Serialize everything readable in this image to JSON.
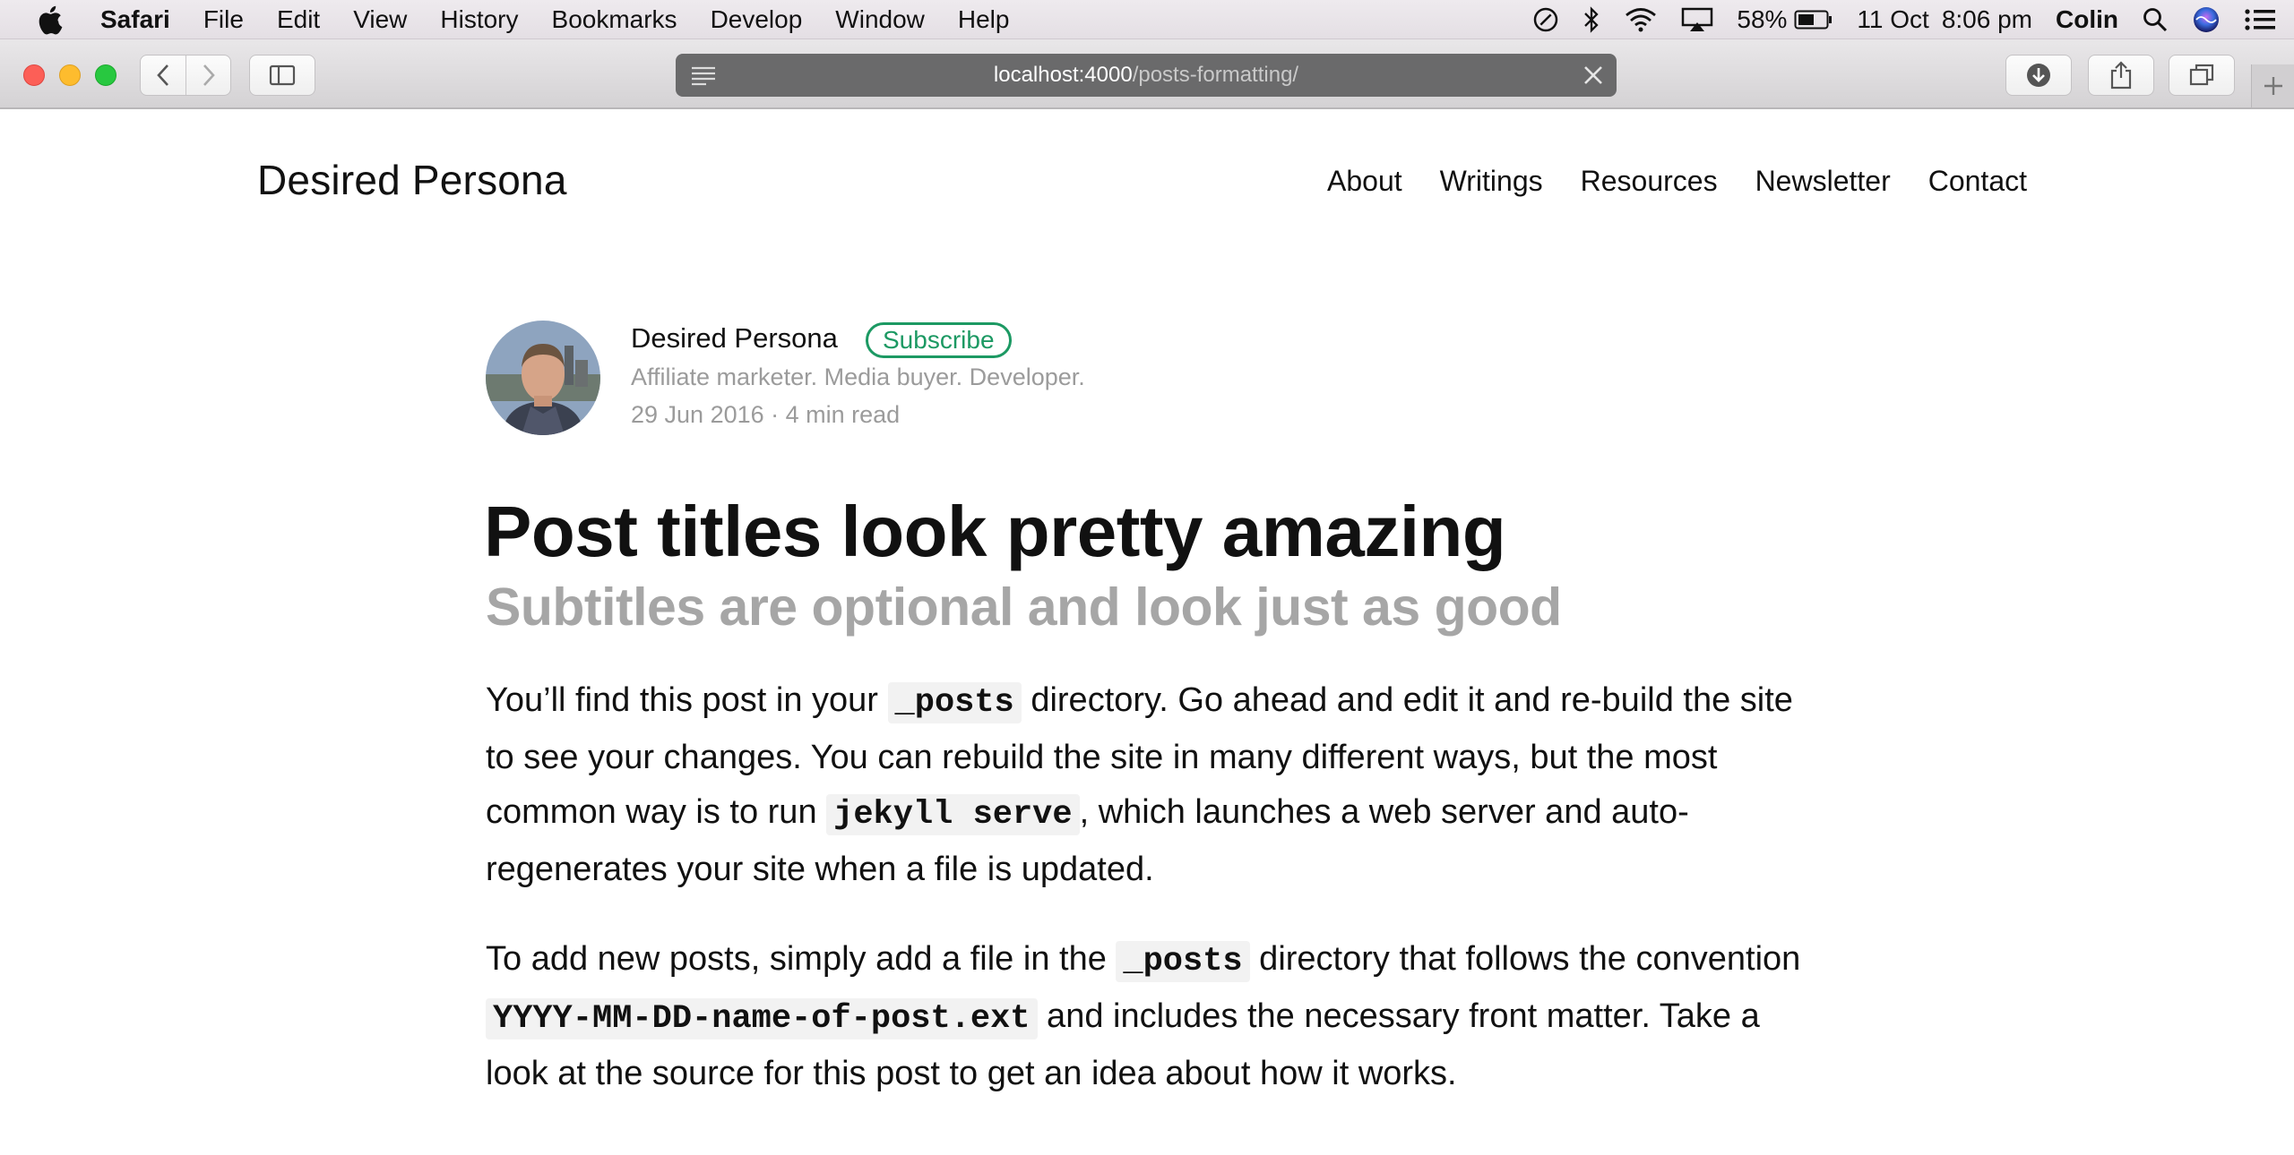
{
  "menubar": {
    "app_name": "Safari",
    "items": [
      "File",
      "Edit",
      "View",
      "History",
      "Bookmarks",
      "Develop",
      "Window",
      "Help"
    ],
    "battery": "58%",
    "date": "11 Oct",
    "time": "8:06 pm",
    "user": "Colin"
  },
  "browser": {
    "url_host": "localhost:4000",
    "url_path": "/posts-formatting/"
  },
  "site": {
    "title": "Desired Persona",
    "nav": [
      "About",
      "Writings",
      "Resources",
      "Newsletter",
      "Contact"
    ]
  },
  "author": {
    "name": "Desired Persona",
    "subscribe_label": "Subscribe",
    "bio": "Affiliate marketer. Media buyer. Developer.",
    "meta": "29 Jun 2016 · 4 min read"
  },
  "post": {
    "title": "Post titles look pretty amazing",
    "subtitle": "Subtitles are optional and look just as good",
    "p1": {
      "t1": "You’ll find this post in your ",
      "c1": "_posts",
      "t2": " directory. Go ahead and edit it and re-build the site to see your changes. You can rebuild the site in many different ways, but the most common way is to run ",
      "c2": "jekyll serve",
      "t3": ", which launches a web server and auto-regenerates your site when a file is updated."
    },
    "p2": {
      "t1": "To add new posts, simply add a file in the ",
      "c1": "_posts",
      "t2": " directory that follows the convention ",
      "c2": "YYYY-MM-DD-name-of-post.ext",
      "t3": " and includes the necessary front matter. Take a look at the source for this post to get an idea about how it works."
    }
  },
  "colors": {
    "accent": "#1c9963",
    "muted": "#9b9b9b",
    "subtitle": "#a6a6a6"
  }
}
